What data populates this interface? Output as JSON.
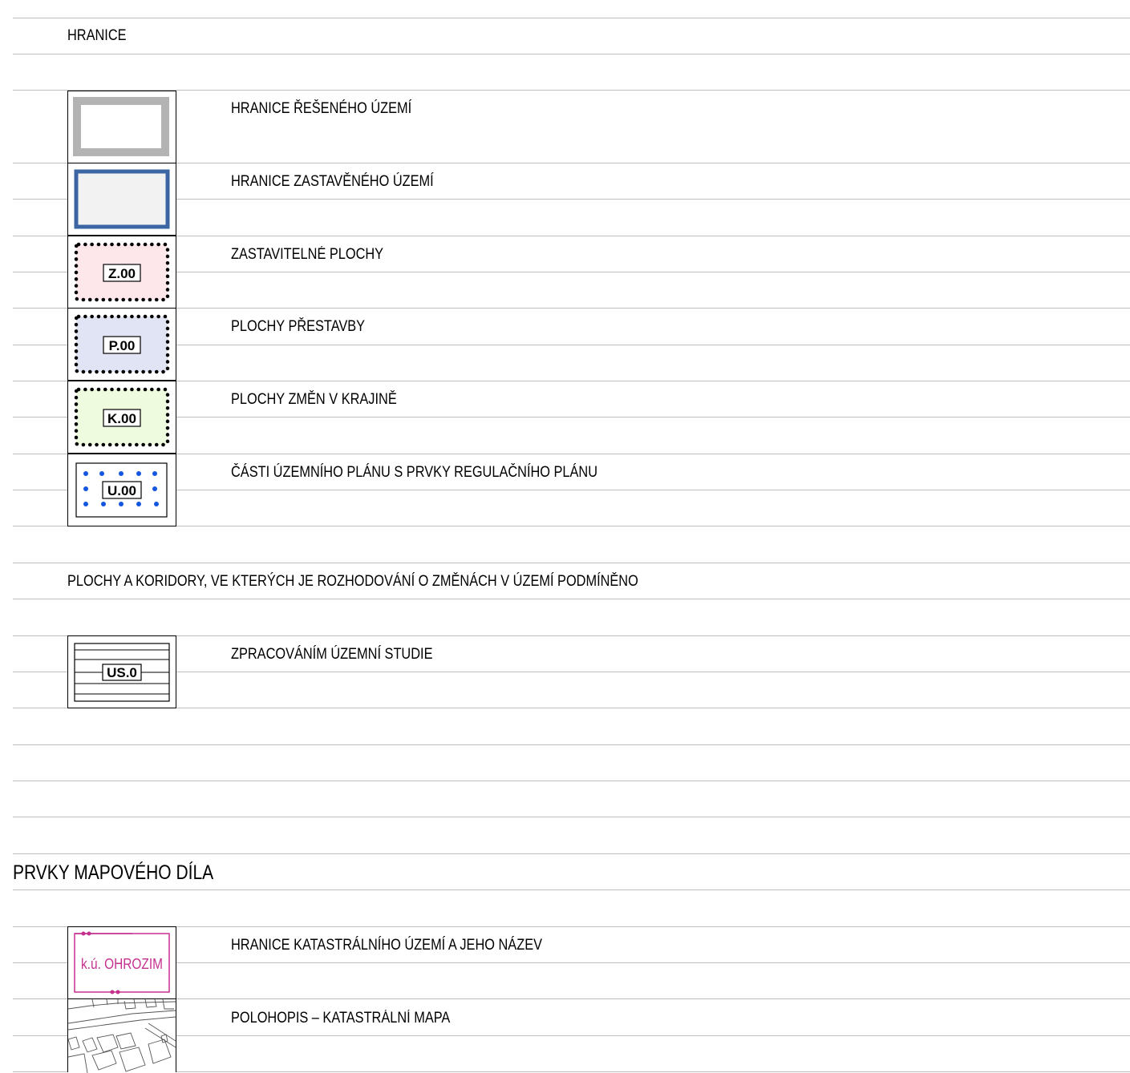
{
  "sections": {
    "hranice": {
      "title": "HRANICE"
    },
    "podminene": {
      "title": "PLOCHY A KORIDORY, VE KTERÝCH JE ROZHODOVÁNÍ O ZMĚNÁCH V ÚZEMÍ PODMÍNĚNO"
    },
    "mapove": {
      "title": "PRVKY MAPOVÉHO DÍLA"
    }
  },
  "legend": [
    {
      "label": "HRANICE ŘEŠENÉHO ÚZEMÍ",
      "symbol": "grey-frame",
      "code": ""
    },
    {
      "label": "HRANICE ZASTAVĚNÉHO ÚZEMÍ",
      "symbol": "blue-frame",
      "code": ""
    },
    {
      "label": "ZASTAVITELNÉ PLOCHY",
      "symbol": "dotted-pink",
      "code": "Z.00"
    },
    {
      "label": "PLOCHY PŘESTAVBY",
      "symbol": "dotted-blue",
      "code": "P.00"
    },
    {
      "label": "PLOCHY ZMĚN V KRAJINĚ",
      "symbol": "dotted-green",
      "code": "K.00"
    },
    {
      "label": "ČÁSTI ÚZEMNÍHO PLÁNU S PRVKY REGULAČNÍHO PLÁNU",
      "symbol": "blue-dots",
      "code": "U.00"
    },
    {
      "label": "ZPRACOVÁNÍM ÚZEMNÍ STUDIE",
      "symbol": "striped",
      "code": "US.0"
    },
    {
      "label": "HRANICE KATASTRÁLNÍHO ÚZEMÍ A JEHO NÁZEV",
      "symbol": "magenta-frame",
      "code": "k.ú. OHROZIM"
    },
    {
      "label": "POLOHOPIS – KATASTRÁLNÍ MAPA",
      "symbol": "cadastral-map",
      "code": ""
    }
  ],
  "colors": {
    "rule": "#bdbdbd",
    "grey_frame": "#b3b3b3",
    "blue_frame": "#3b66a3",
    "pink_fill": "#fde7ea",
    "lavender_fill": "#e1e4f4",
    "green_fill": "#eefbdf",
    "blue_dot": "#1556e0",
    "magenta": "#c5308f"
  }
}
